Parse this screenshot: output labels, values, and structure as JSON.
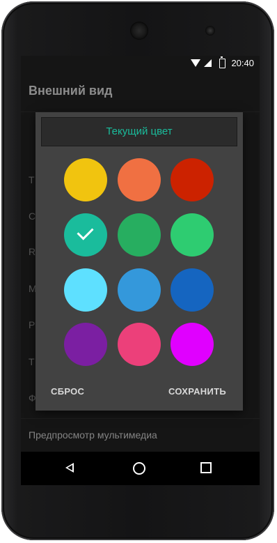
{
  "status_bar": {
    "time": "20:40"
  },
  "screen": {
    "title": "Внешний вид",
    "bg_items": [
      "Т",
      "С",
      "R",
      "М",
      "Р",
      "Т",
      "Ф"
    ],
    "preview_item": "Предпросмотр мультимедиа"
  },
  "dialog": {
    "current_color_label": "Текущий цвет",
    "current_color": "#1abc9c",
    "swatches": [
      "#f1c40f",
      "#f07042",
      "#cc2200",
      "#1abc9c",
      "#27ae60",
      "#2ecc71",
      "#5ee0ff",
      "#3498db",
      "#1565c0",
      "#7b1fa2",
      "#ec407a",
      "#e000ff"
    ],
    "selected_index": 3,
    "reset_label": "СБРОС",
    "save_label": "СОХРАНИТЬ"
  },
  "navbar": {
    "icons": [
      "back-icon",
      "home-icon",
      "recents-icon"
    ]
  }
}
